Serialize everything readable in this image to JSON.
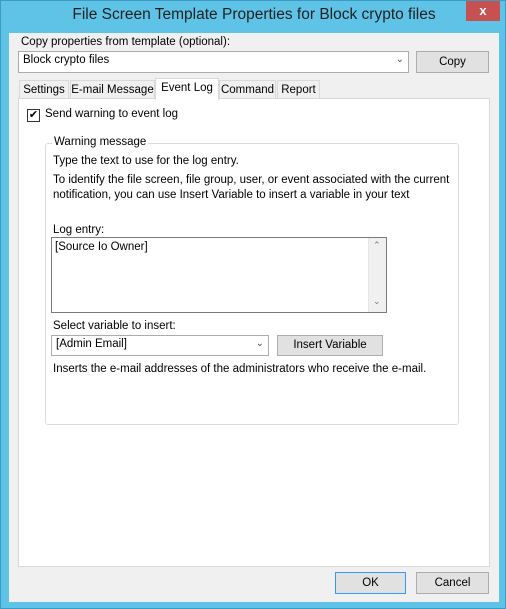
{
  "window": {
    "title": "File Screen Template Properties for Block crypto files",
    "close_label": "x"
  },
  "copy": {
    "label": "Copy properties from template (optional):",
    "value": "Block crypto files",
    "button": "Copy"
  },
  "tabs": [
    "Settings",
    "E-mail Message",
    "Event Log",
    "Command",
    "Report"
  ],
  "selected_tab": "Event Log",
  "event_log": {
    "send_warning_label": "Send warning to event log",
    "send_warning_checked": true,
    "group_title": "Warning message",
    "instruction": "Type the text to use for the log entry.",
    "hint_line1": "To identify the file screen, file group, user, or event associated with the current",
    "hint_line2": "notification, you can use Insert Variable to insert a variable in your text",
    "log_entry_label": "Log entry:",
    "log_entry_value": "[Source Io Owner]",
    "variable_label": "Select variable to insert:",
    "variable_value": "[Admin Email]",
    "insert_button": "Insert Variable",
    "variable_description": "Inserts the e-mail addresses of the administrators who receive the e-mail."
  },
  "footer": {
    "ok": "OK",
    "cancel": "Cancel"
  }
}
